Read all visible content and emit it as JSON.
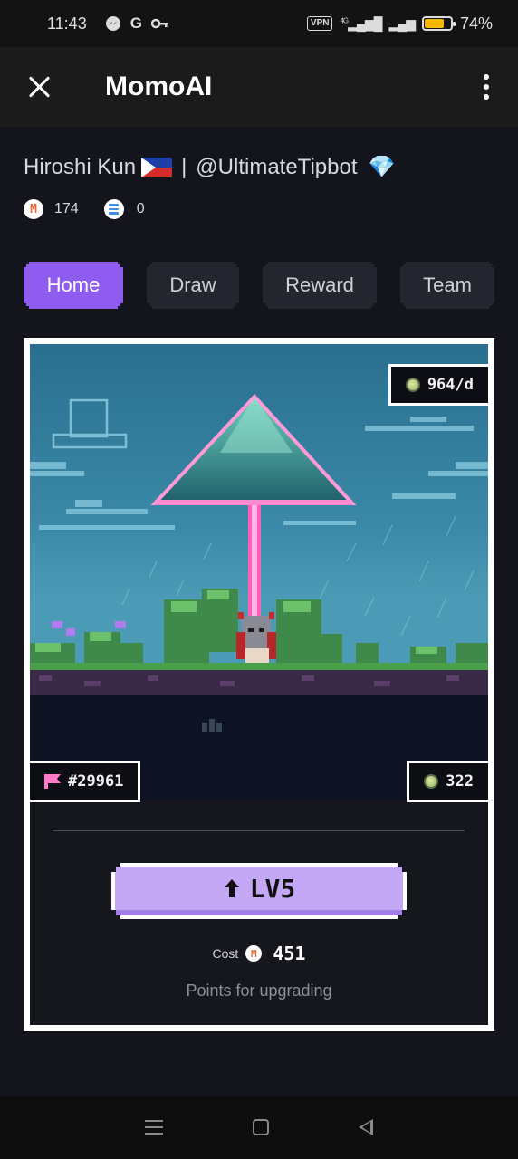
{
  "status_bar": {
    "time": "11:43",
    "notification_icons": [
      "messenger-icon",
      "google-icon",
      "key-icon"
    ],
    "vpn": "VPN",
    "network": "4G",
    "battery": "74%",
    "battery_level": 0.74
  },
  "app_bar": {
    "title": "MomoAI",
    "close_icon": "close-icon",
    "menu_icon": "more-vert-icon"
  },
  "user": {
    "name": "Hiroshi Kun",
    "separator": "|",
    "handle": "@UltimateTipbot",
    "flag_icon": "philippines-flag-icon",
    "badge_icon": "diamond-icon"
  },
  "balances": {
    "momo_symbol": "M",
    "momo": "174",
    "token": "0"
  },
  "tabs": [
    {
      "label": "Home",
      "active": true
    },
    {
      "label": "Draw",
      "active": false
    },
    {
      "label": "Reward",
      "active": false
    },
    {
      "label": "Team",
      "active": false
    }
  ],
  "card": {
    "rate": "964/d",
    "id": "#29961",
    "coins": "322",
    "upgrade_label": "LV5",
    "cost_label": "Cost",
    "cost_value": "451",
    "hint": "Points for upgrading"
  },
  "colors": {
    "accent": "#8f5cf0",
    "upgrade_button": "#c4a8f6",
    "background": "#14151c",
    "tab_bg": "#23262f"
  }
}
